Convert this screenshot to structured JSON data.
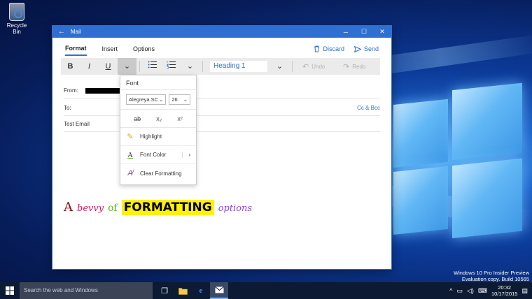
{
  "desktop": {
    "icons": [
      {
        "label": "Recycle Bin"
      }
    ],
    "watermark": {
      "line1": "Windows 10 Pro Insider Preview",
      "line2": "Evaluation copy. Build 10565"
    }
  },
  "window": {
    "title": "Mail",
    "controls": {
      "back": "←",
      "minimize": "─",
      "maximize": "☐",
      "close": "✕"
    },
    "tabs": [
      {
        "label": "Format",
        "active": true
      },
      {
        "label": "Insert"
      },
      {
        "label": "Options"
      }
    ],
    "actions": {
      "discard": "Discard",
      "send": "Send"
    },
    "toolbar": {
      "bold": "B",
      "italic": "I",
      "underline": "U",
      "style_value": "Heading 1",
      "undo": "Undo",
      "redo": "Redo"
    },
    "fields": {
      "from_label": "From:",
      "to_label": "To:",
      "cc_bcc": "Cc & Bcc",
      "subject": "Test Email"
    },
    "body": {
      "w1": "A",
      "w2": "bevvy",
      "w3": "of",
      "w4": "FORMATTING",
      "w5": "options"
    }
  },
  "font_flyout": {
    "title": "Font",
    "font_name": "Alegreya SC",
    "font_size": "26",
    "strikethrough": "ab",
    "subscript": "x₂",
    "superscript": "x²",
    "items": [
      {
        "label": "Highlight"
      },
      {
        "label": "Font Color"
      },
      {
        "label": "Clear Formatting"
      }
    ]
  },
  "taskbar": {
    "search_placeholder": "Search the web and Windows",
    "time": "20:32",
    "date": "10/17/2015"
  },
  "colors": {
    "accent": "#2f6fd1",
    "highlight": "#fff200",
    "taskbar": "#0c1a33"
  }
}
